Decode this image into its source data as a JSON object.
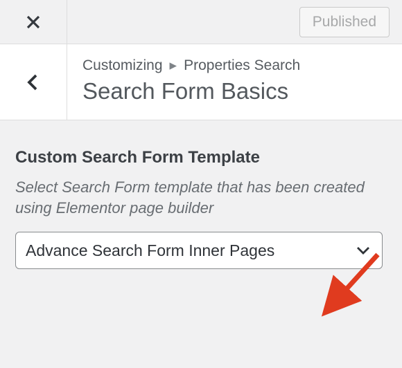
{
  "topbar": {
    "published_label": "Published"
  },
  "breadcrumb": {
    "root": "Customizing",
    "section": "Properties Search"
  },
  "title": "Search Form Basics",
  "control": {
    "label": "Custom Search Form Template",
    "description": "Select Search Form template that has been created using Elementor page builder",
    "selected": "Advance Search Form Inner Pages"
  }
}
